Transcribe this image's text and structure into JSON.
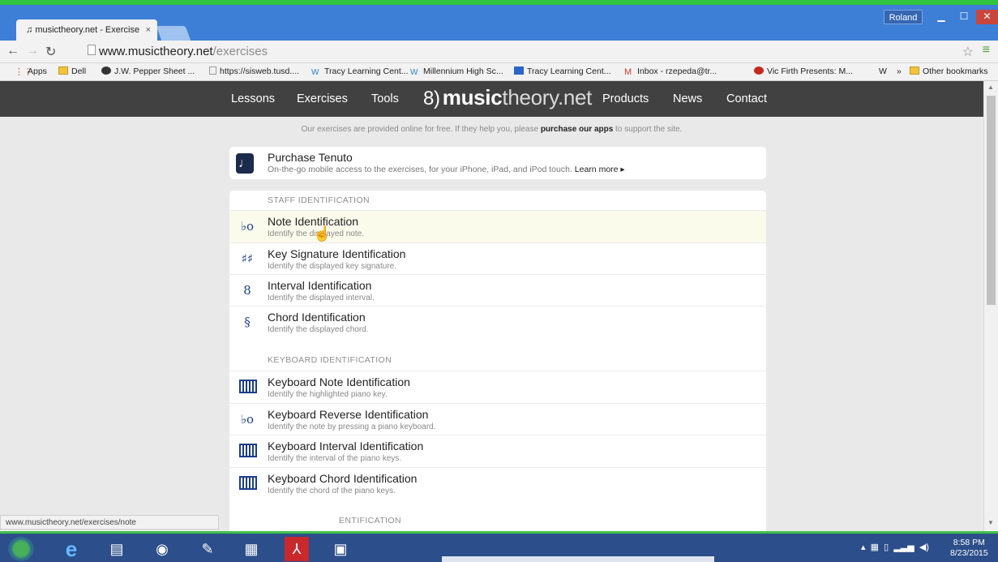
{
  "browser": {
    "tab_title": "musictheory.net - Exercise",
    "tab_close": "×",
    "user": "Roland",
    "url_host": "www.musictheory.net",
    "url_path": "/exercises",
    "bookmarks": [
      {
        "label": "Apps"
      },
      {
        "label": "Dell"
      },
      {
        "label": "J.W. Pepper Sheet ..."
      },
      {
        "label": "https://sisweb.tusd...."
      },
      {
        "label": "Tracy Learning Cent..."
      },
      {
        "label": "Millennium High Sc..."
      },
      {
        "label": "Tracy Learning Cent..."
      },
      {
        "label": "Inbox - rzepeda@tr..."
      },
      {
        "label": "Vic Firth Presents: M..."
      },
      {
        "label": "»"
      },
      {
        "label": "Other bookmarks"
      }
    ],
    "status_url": "www.musictheory.net/exercises/note"
  },
  "site": {
    "nav": {
      "lessons": "Lessons",
      "exercises": "Exercises",
      "tools": "Tools",
      "logo_bold": "music",
      "logo_light": "theory.net",
      "products": "Products",
      "news": "News",
      "contact": "Contact"
    },
    "promo": {
      "before": "Our exercises are provided online for free. If they help you, please ",
      "link": "purchase our apps",
      "after": " to support the site."
    },
    "tenuto": {
      "title": "Purchase Tenuto",
      "desc": "On-the-go mobile access to the exercises, for your iPhone, iPad, and iPod touch.",
      "more": "Learn more ▸"
    },
    "sections": [
      {
        "heading": "STAFF IDENTIFICATION",
        "items": [
          {
            "title": "Note Identification",
            "desc": "Identify the displayed note.",
            "icon": "flat-note-icon"
          },
          {
            "title": "Key Signature Identification",
            "desc": "Identify the displayed key signature.",
            "icon": "sharps-icon"
          },
          {
            "title": "Interval Identification",
            "desc": "Identify the displayed interval.",
            "icon": "interval-icon"
          },
          {
            "title": "Chord Identification",
            "desc": "Identify the displayed chord.",
            "icon": "chord-icon"
          }
        ]
      },
      {
        "heading": "KEYBOARD IDENTIFICATION",
        "items": [
          {
            "title": "Keyboard Note Identification",
            "desc": "Identify the highlighted piano key.",
            "icon": "keyboard-icon"
          },
          {
            "title": "Keyboard Reverse Identification",
            "desc": "Identify the note by pressing a piano keyboard.",
            "icon": "flat-note-icon"
          },
          {
            "title": "Keyboard Interval Identification",
            "desc": "Identify the interval of the piano keys.",
            "icon": "keyboard-icon"
          },
          {
            "title": "Keyboard Chord Identification",
            "desc": "Identify the chord of the piano keys.",
            "icon": "keyboard-icon"
          }
        ]
      }
    ],
    "partial_heading": "ENTIFICATION"
  },
  "taskbar": {
    "time": "8:58 PM",
    "date": "8/23/2015"
  },
  "colors": {
    "titlebar": "#3d7fd6",
    "site_nav": "#414141",
    "accent_green": "#31c33b",
    "icon_blue": "#1d3d8a"
  }
}
